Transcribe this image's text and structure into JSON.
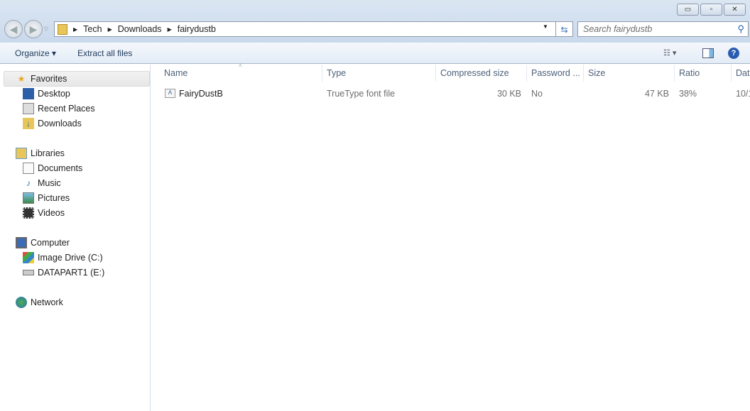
{
  "window": {
    "minimize": "▭",
    "restore": "▫",
    "close": "✕"
  },
  "address": {
    "segments": [
      "Tech",
      "Downloads",
      "fairydustb"
    ]
  },
  "search": {
    "placeholder": "Search fairydustb"
  },
  "toolbar": {
    "organize": "Organize ▾",
    "extract": "Extract all files"
  },
  "sidebar": {
    "favorites": "Favorites",
    "desktop": "Desktop",
    "recent": "Recent Places",
    "downloads": "Downloads",
    "libraries": "Libraries",
    "documents": "Documents",
    "music": "Music",
    "pictures": "Pictures",
    "videos": "Videos",
    "computer": "Computer",
    "c_drive": "Image Drive (C:)",
    "e_drive": "DATAPART1 (E:)",
    "network": "Network"
  },
  "columns": [
    "Name",
    "Type",
    "Compressed size",
    "Password ...",
    "Size",
    "Ratio",
    "Date"
  ],
  "files": [
    {
      "name": "FairyDustB",
      "type": "TrueType font file",
      "compressed": "30 KB",
      "password": "No",
      "size": "47 KB",
      "ratio": "38%",
      "date": "10/1"
    }
  ]
}
